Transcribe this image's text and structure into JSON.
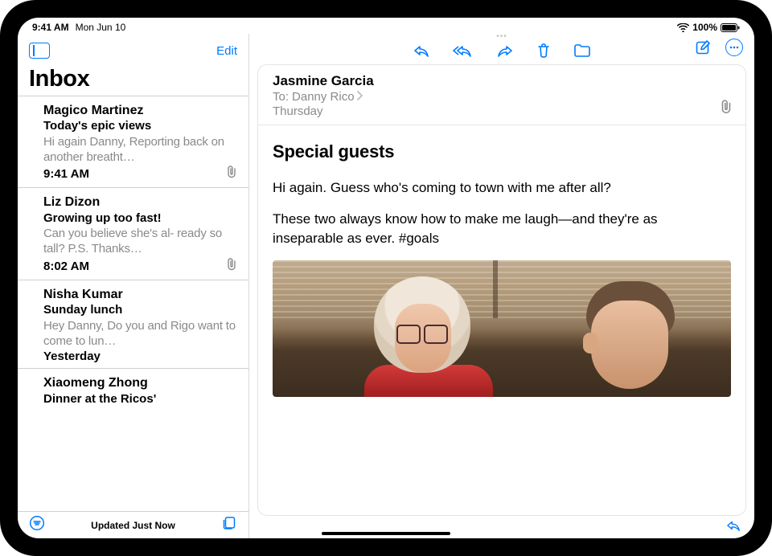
{
  "status": {
    "time": "9:41 AM",
    "date": "Mon Jun 10",
    "battery_pct": "100%"
  },
  "sidebar": {
    "edit_label": "Edit",
    "title": "Inbox",
    "footer_status": "Updated Just Now"
  },
  "mails": [
    {
      "sender": "Magico Martinez",
      "subject": "Today's epic views",
      "preview": "Hi again Danny, Reporting back on another breatht…",
      "time": "9:41 AM",
      "has_attachment": true
    },
    {
      "sender": "Liz Dizon",
      "subject": "Growing up too fast!",
      "preview": "Can you believe she's al- ready so tall? P.S. Thanks…",
      "time": "8:02 AM",
      "has_attachment": true
    },
    {
      "sender": "Nisha Kumar",
      "subject": "Sunday lunch",
      "preview": "Hey Danny, Do you and Rigo want to come to lun…",
      "time": "Yesterday",
      "has_attachment": false
    },
    {
      "sender": "Xiaomeng Zhong",
      "subject": "Dinner at the Ricos'",
      "preview": "",
      "time": "",
      "has_attachment": false
    }
  ],
  "message": {
    "from": "Jasmine Garcia",
    "to_label": "To:",
    "to_name": "Danny Rico",
    "date": "Thursday",
    "has_attachment": true,
    "subject": "Special guests",
    "body": [
      "Hi again. Guess who's coming to town with me after all?",
      "These two always know how to make me laugh—and they're as inseparable as ever. #goals"
    ]
  }
}
